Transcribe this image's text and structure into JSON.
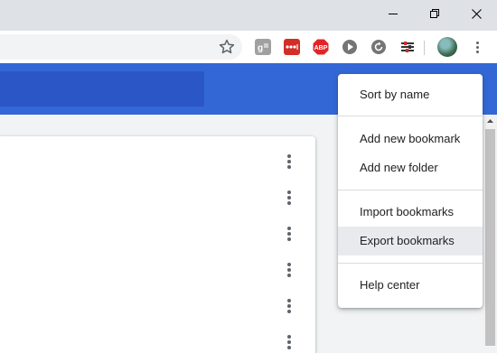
{
  "window": {
    "minimize_icon": "minimize-icon",
    "restore_icon": "restore-icon",
    "close_icon": "close-icon"
  },
  "toolbar": {
    "bookmark_star_icon": "star-outline-icon",
    "extensions": [
      {
        "name": "google-plus-icon",
        "color": "#9e9e9e"
      },
      {
        "name": "lastpass-icon",
        "color": "#d32d27",
        "text": "•••|"
      },
      {
        "name": "adblock-plus-icon",
        "color": "#e32424",
        "text": "ABP"
      },
      {
        "name": "play-icon",
        "color": "#757575"
      },
      {
        "name": "refresh-extension-icon",
        "color": "#757575"
      },
      {
        "name": "equalizer-icon",
        "color": "#333333"
      }
    ],
    "avatar_icon": "profile-avatar-icon",
    "menu_icon": "more-vert-icon"
  },
  "colors": {
    "header": "#3367d6",
    "search_bar": "#2a56c6",
    "menu_hover": "#e8eaed"
  },
  "row_menus": [
    "more-vert-icon",
    "more-vert-icon",
    "more-vert-icon",
    "more-vert-icon",
    "more-vert-icon",
    "more-vert-icon"
  ],
  "menu": {
    "items": [
      {
        "label": "Sort by name"
      },
      {
        "label": "Add new bookmark"
      },
      {
        "label": "Add new folder"
      },
      {
        "label": "Import bookmarks"
      },
      {
        "label": "Export bookmarks",
        "highlighted": true
      },
      {
        "label": "Help center"
      }
    ]
  }
}
